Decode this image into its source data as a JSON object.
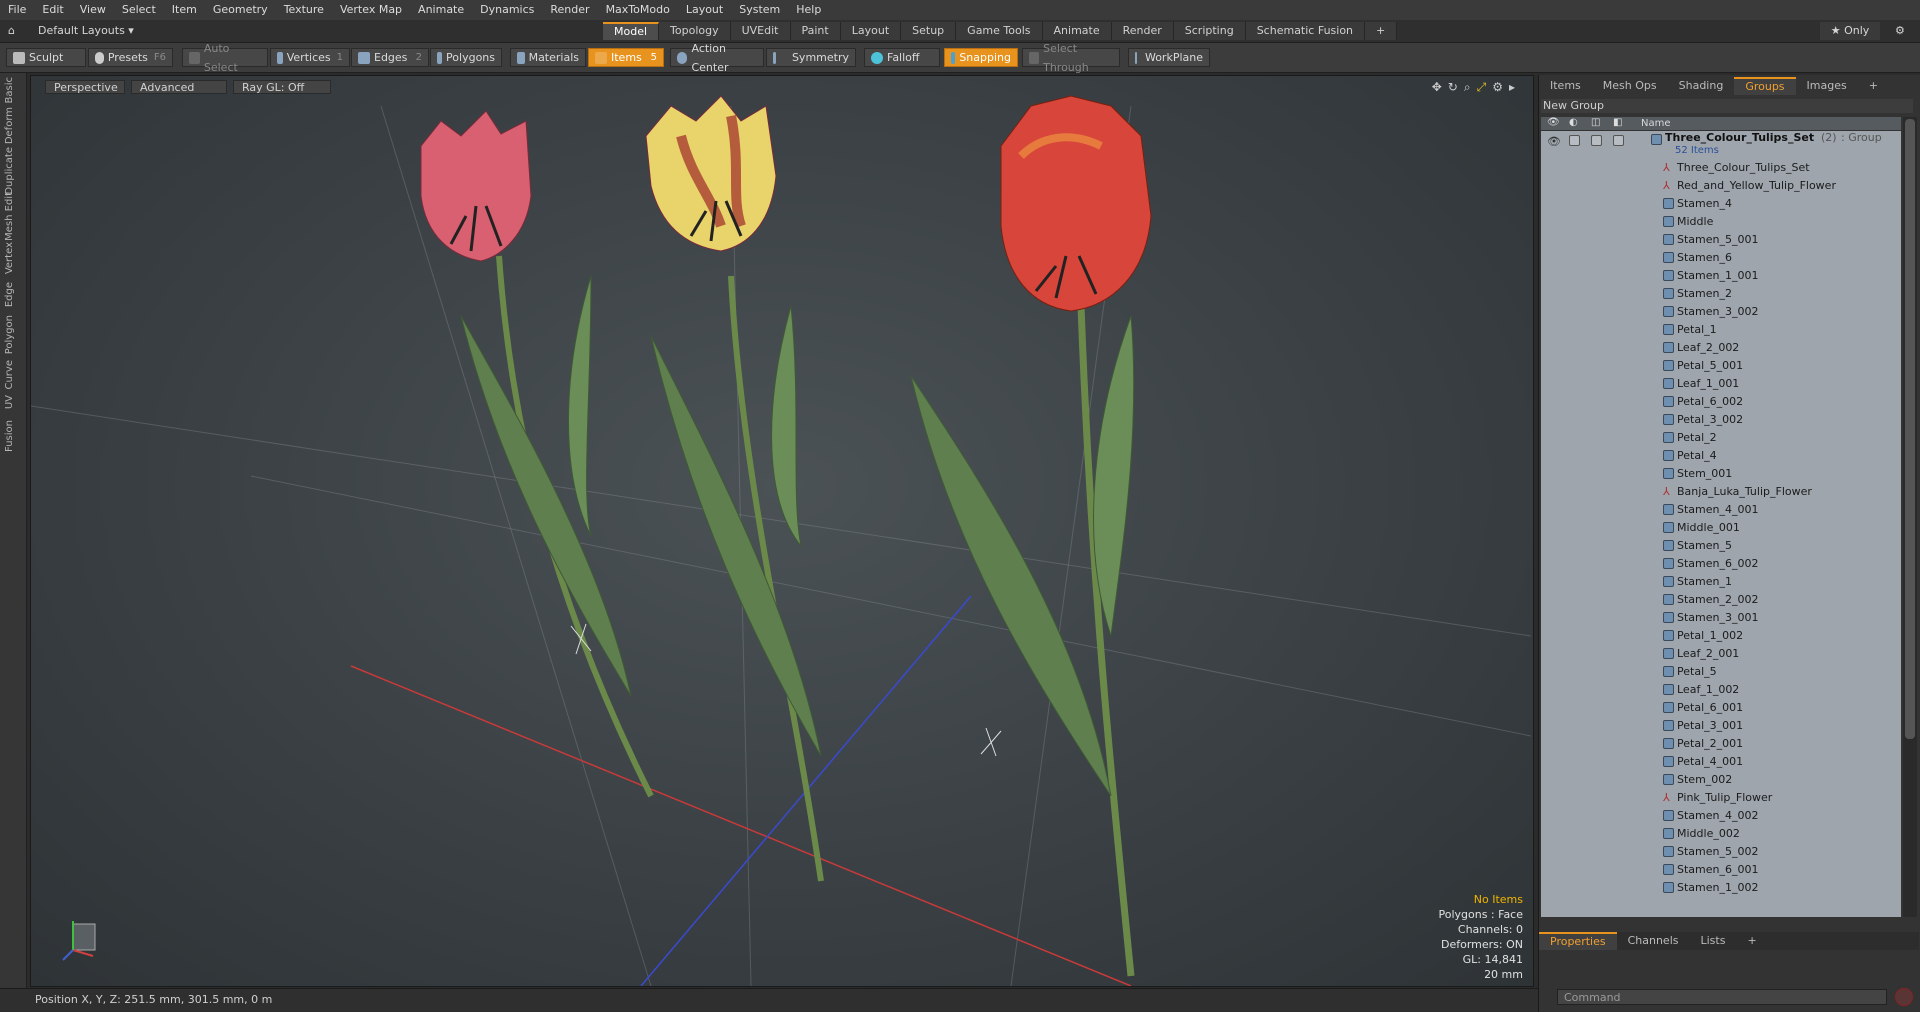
{
  "menu": [
    "File",
    "Edit",
    "View",
    "Select",
    "Item",
    "Geometry",
    "Texture",
    "Vertex Map",
    "Animate",
    "Dynamics",
    "Render",
    "MaxToModo",
    "Layout",
    "System",
    "Help"
  ],
  "layout": {
    "selector": "Default Layouts ▾",
    "only_label": "★ Only"
  },
  "tabs": [
    {
      "label": "Model",
      "active": true
    },
    {
      "label": "Topology"
    },
    {
      "label": "UVEdit"
    },
    {
      "label": "Paint"
    },
    {
      "label": "Layout"
    },
    {
      "label": "Setup"
    },
    {
      "label": "Game Tools"
    },
    {
      "label": "Animate"
    },
    {
      "label": "Render"
    },
    {
      "label": "Scripting"
    },
    {
      "label": "Schematic Fusion"
    },
    {
      "label": "+"
    }
  ],
  "toolbar": {
    "sculpt": "Sculpt",
    "presets": "Presets",
    "presets_key": "F6",
    "auto_select": "Auto Select",
    "vertices": "Vertices",
    "vertices_key": "1",
    "edges": "Edges",
    "edges_key": "2",
    "polygons": "Polygons",
    "materials": "Materials",
    "items": "Items",
    "items_key": "5",
    "action_center": "Action Center",
    "symmetry": "Symmetry",
    "falloff": "Falloff",
    "snapping": "Snapping",
    "select_through": "Select Through",
    "workplane": "WorkPlane"
  },
  "left_tabs": [
    "Basic",
    "Deform",
    "Duplicate",
    "Mesh Edit",
    "Vertex",
    "Edge",
    "Polygon",
    "Curve",
    "UV",
    "Fusion"
  ],
  "viewport": {
    "view": "Perspective",
    "mode": "Advanced",
    "raygl": "Ray GL: Off",
    "stats": {
      "selection": "No Items",
      "polygons": "Polygons : Face",
      "channels": "Channels: 0",
      "deformers": "Deformers: ON",
      "gl": "GL: 14,841",
      "scale": "20 mm"
    }
  },
  "status": {
    "position": "Position X, Y, Z:   251.5 mm, 301.5 mm, 0 m"
  },
  "panel": {
    "tabs": [
      {
        "label": "Items"
      },
      {
        "label": "Mesh Ops"
      },
      {
        "label": "Shading"
      },
      {
        "label": "Groups",
        "active": true
      },
      {
        "label": "Images"
      },
      {
        "label": "+"
      }
    ],
    "new_group": "New Group",
    "column_name": "Name",
    "group": {
      "name": "Three_Colour_Tulips_Set",
      "count": "(2)",
      "type": ": Group",
      "items": "52 Items"
    },
    "items": [
      {
        "name": "Three_Colour_Tulips_Set",
        "kind": "locator"
      },
      {
        "name": "Red_and_Yellow_Tulip_Flower",
        "kind": "locator"
      },
      {
        "name": "Stamen_4",
        "kind": "mesh"
      },
      {
        "name": "Middle",
        "kind": "mesh"
      },
      {
        "name": "Stamen_5_001",
        "kind": "mesh"
      },
      {
        "name": "Stamen_6",
        "kind": "mesh"
      },
      {
        "name": "Stamen_1_001",
        "kind": "mesh"
      },
      {
        "name": "Stamen_2",
        "kind": "mesh"
      },
      {
        "name": "Stamen_3_002",
        "kind": "mesh"
      },
      {
        "name": "Petal_1",
        "kind": "mesh"
      },
      {
        "name": "Leaf_2_002",
        "kind": "mesh"
      },
      {
        "name": "Petal_5_001",
        "kind": "mesh"
      },
      {
        "name": "Leaf_1_001",
        "kind": "mesh"
      },
      {
        "name": "Petal_6_002",
        "kind": "mesh"
      },
      {
        "name": "Petal_3_002",
        "kind": "mesh"
      },
      {
        "name": "Petal_2",
        "kind": "mesh"
      },
      {
        "name": "Petal_4",
        "kind": "mesh"
      },
      {
        "name": "Stem_001",
        "kind": "mesh"
      },
      {
        "name": "Banja_Luka_Tulip_Flower",
        "kind": "locator"
      },
      {
        "name": "Stamen_4_001",
        "kind": "mesh"
      },
      {
        "name": "Middle_001",
        "kind": "mesh"
      },
      {
        "name": "Stamen_5",
        "kind": "mesh"
      },
      {
        "name": "Stamen_6_002",
        "kind": "mesh"
      },
      {
        "name": "Stamen_1",
        "kind": "mesh"
      },
      {
        "name": "Stamen_2_002",
        "kind": "mesh"
      },
      {
        "name": "Stamen_3_001",
        "kind": "mesh"
      },
      {
        "name": "Petal_1_002",
        "kind": "mesh"
      },
      {
        "name": "Leaf_2_001",
        "kind": "mesh"
      },
      {
        "name": "Petal_5",
        "kind": "mesh"
      },
      {
        "name": "Leaf_1_002",
        "kind": "mesh"
      },
      {
        "name": "Petal_6_001",
        "kind": "mesh"
      },
      {
        "name": "Petal_3_001",
        "kind": "mesh"
      },
      {
        "name": "Petal_2_001",
        "kind": "mesh"
      },
      {
        "name": "Petal_4_001",
        "kind": "mesh"
      },
      {
        "name": "Stem_002",
        "kind": "mesh"
      },
      {
        "name": "Pink_Tulip_Flower",
        "kind": "locator"
      },
      {
        "name": "Stamen_4_002",
        "kind": "mesh"
      },
      {
        "name": "Middle_002",
        "kind": "mesh"
      },
      {
        "name": "Stamen_5_002",
        "kind": "mesh"
      },
      {
        "name": "Stamen_6_001",
        "kind": "mesh"
      },
      {
        "name": "Stamen_1_002",
        "kind": "mesh"
      }
    ],
    "bottom_tabs": [
      {
        "label": "Properties",
        "active": true
      },
      {
        "label": "Channels"
      },
      {
        "label": "Lists"
      },
      {
        "label": "+"
      }
    ],
    "command_placeholder": "Command"
  },
  "colors": {
    "accent": "#e8931d",
    "list_bg": "#9ea5ad",
    "red_petal": "#d8453a",
    "yellow_petal": "#e8d46a",
    "pink_petal": "#d86070",
    "leaf": "#5f7f4f"
  }
}
